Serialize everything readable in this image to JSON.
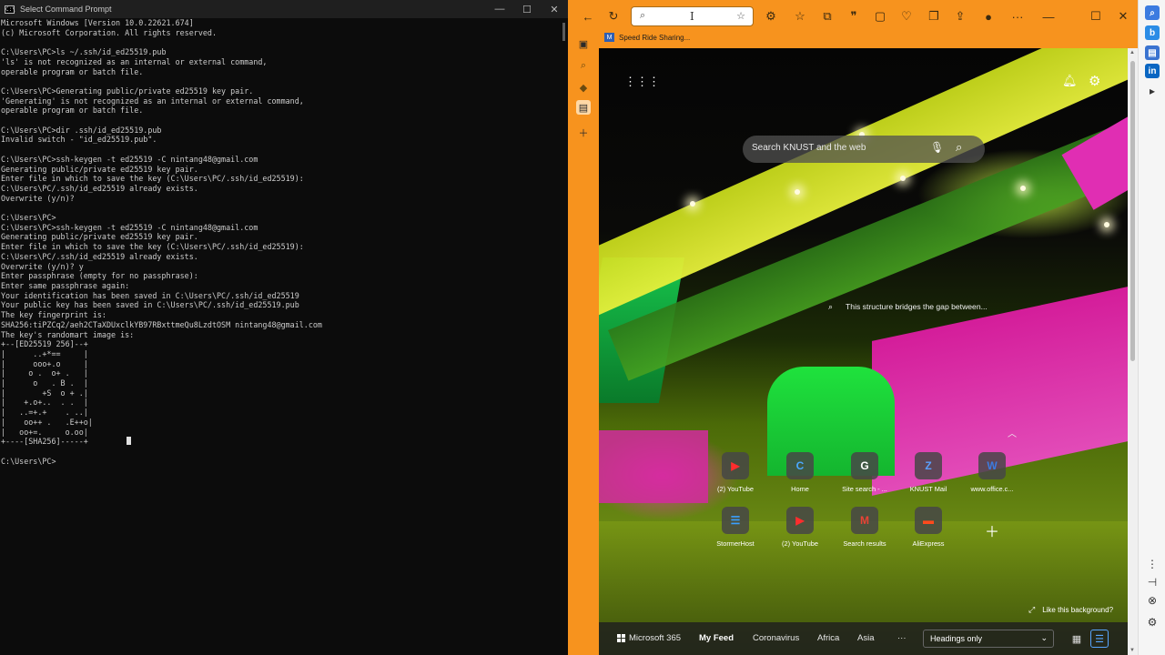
{
  "cmd": {
    "title": "Select Command Prompt",
    "lines": [
      "Microsoft Windows [Version 10.0.22621.674]",
      "(c) Microsoft Corporation. All rights reserved.",
      "",
      "C:\\Users\\PC>ls ~/.ssh/id_ed25519.pub",
      "'ls' is not recognized as an internal or external command,",
      "operable program or batch file.",
      "",
      "C:\\Users\\PC>Generating public/private ed25519 key pair.",
      "'Generating' is not recognized as an internal or external command,",
      "operable program or batch file.",
      "",
      "C:\\Users\\PC>dir .ssh/id_ed25519.pub",
      "Invalid switch - \"id_ed25519.pub\".",
      "",
      "C:\\Users\\PC>ssh-keygen -t ed25519 -C nintang48@gmail.com",
      "Generating public/private ed25519 key pair.",
      "Enter file in which to save the key (C:\\Users\\PC/.ssh/id_ed25519):",
      "C:\\Users\\PC/.ssh/id_ed25519 already exists.",
      "Overwrite (y/n)?",
      "",
      "C:\\Users\\PC>",
      "C:\\Users\\PC>ssh-keygen -t ed25519 -C nintang48@gmail.com",
      "Generating public/private ed25519 key pair.",
      "Enter file in which to save the key (C:\\Users\\PC/.ssh/id_ed25519):",
      "C:\\Users\\PC/.ssh/id_ed25519 already exists.",
      "Overwrite (y/n)? y",
      "Enter passphrase (empty for no passphrase):",
      "Enter same passphrase again:",
      "Your identification has been saved in C:\\Users\\PC/.ssh/id_ed25519",
      "Your public key has been saved in C:\\Users\\PC/.ssh/id_ed25519.pub",
      "The key fingerprint is:",
      "SHA256:tiPZCq2/aeh2CTaXDUxclkYB97RBxttmeQu8LzdtOSM nintang48@gmail.com",
      "The key's randomart image is:",
      "+--[ED25519 256]--+",
      "|      ..+*==     |",
      "|      ooo+.o     |",
      "|     o .  o+ .   |",
      "|      o   . B .  |",
      "|        +S  o + .|",
      "|    +.o+..  . .  |",
      "|   ..=+.+    . ..|",
      "|    oo++ .   .E++o|",
      "|   oo+=.     o.oo|",
      "+----[SHA256]-----+",
      "",
      "C:\\Users\\PC>"
    ]
  },
  "browser": {
    "bookmark_label": "Speed Ride Sharing...",
    "search_placeholder": "Search KNUST and the web",
    "background_caption": "This structure bridges the gap between...",
    "like_background": "Like this background?",
    "tiles_row1": [
      {
        "label": "(2) YouTube",
        "icon": "youtube-icon",
        "color": "#ff2d2d",
        "glyph": "▶"
      },
      {
        "label": "Home",
        "icon": "home-c-icon",
        "color": "#4aa8ff",
        "glyph": "C"
      },
      {
        "label": "Site search - ...",
        "icon": "google-icon",
        "color": "#ffffff",
        "glyph": "G"
      },
      {
        "label": "KNUST Mail",
        "icon": "mail-icon",
        "color": "#5aa0ff",
        "glyph": "Z"
      },
      {
        "label": "www.office.c...",
        "icon": "word-icon",
        "color": "#3b7be0",
        "glyph": "W"
      }
    ],
    "tiles_row2": [
      {
        "label": "StormerHost",
        "icon": "stormerhost-icon",
        "color": "#3aa0ff",
        "glyph": "☰"
      },
      {
        "label": "(2) YouTube",
        "icon": "youtube-icon",
        "color": "#ff2d2d",
        "glyph": "▶"
      },
      {
        "label": "Search results",
        "icon": "gmail-icon",
        "color": "#ea4335",
        "glyph": "M"
      },
      {
        "label": "AliExpress",
        "icon": "aliexpress-icon",
        "color": "#ff4a1c",
        "glyph": "▬"
      }
    ],
    "feed": {
      "microsoft365": "Microsoft 365",
      "my_feed": "My Feed",
      "coronavirus": "Coronavirus",
      "africa": "Africa",
      "asia": "Asia",
      "more": "···",
      "headings": "Headings only"
    }
  },
  "colors": {
    "accent_orange": "#f7931e",
    "terminal_bg": "#0c0c0c",
    "terminal_fg": "#cccccc"
  }
}
